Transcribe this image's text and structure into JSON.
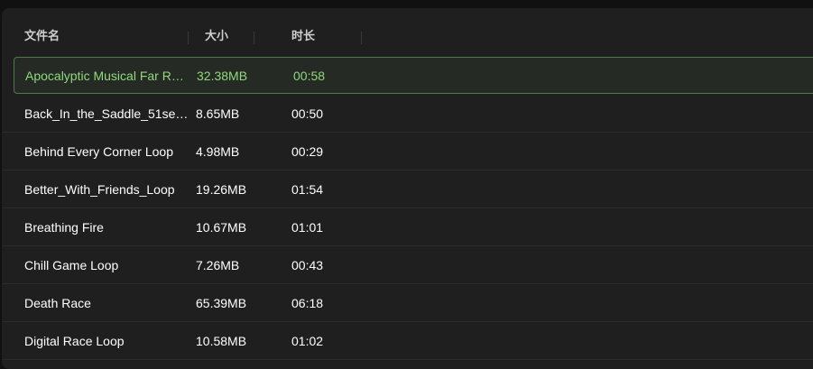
{
  "colors": {
    "background": "#1f1f1f",
    "text": "#ffffff",
    "header_text": "#cfcfcf",
    "active_text": "#8ed97c",
    "active_border": "#4e7a4a"
  },
  "table": {
    "columns": {
      "name": "文件名",
      "size": "大小",
      "duration": "时长"
    },
    "rows": [
      {
        "name": "Apocalyptic Musical Far R…",
        "size": "32.38MB",
        "duration": "00:58",
        "active": true
      },
      {
        "name": "Back_In_the_Saddle_51se…",
        "size": "8.65MB",
        "duration": "00:50"
      },
      {
        "name": "Behind Every Corner Loop",
        "size": "4.98MB",
        "duration": "00:29"
      },
      {
        "name": "Better_With_Friends_Loop",
        "size": "19.26MB",
        "duration": "01:54"
      },
      {
        "name": "Breathing Fire",
        "size": "10.67MB",
        "duration": "01:01"
      },
      {
        "name": "Chill Game Loop",
        "size": "7.26MB",
        "duration": "00:43"
      },
      {
        "name": "Death Race",
        "size": "65.39MB",
        "duration": "06:18"
      },
      {
        "name": "Digital Race Loop",
        "size": "10.58MB",
        "duration": "01:02"
      }
    ]
  }
}
